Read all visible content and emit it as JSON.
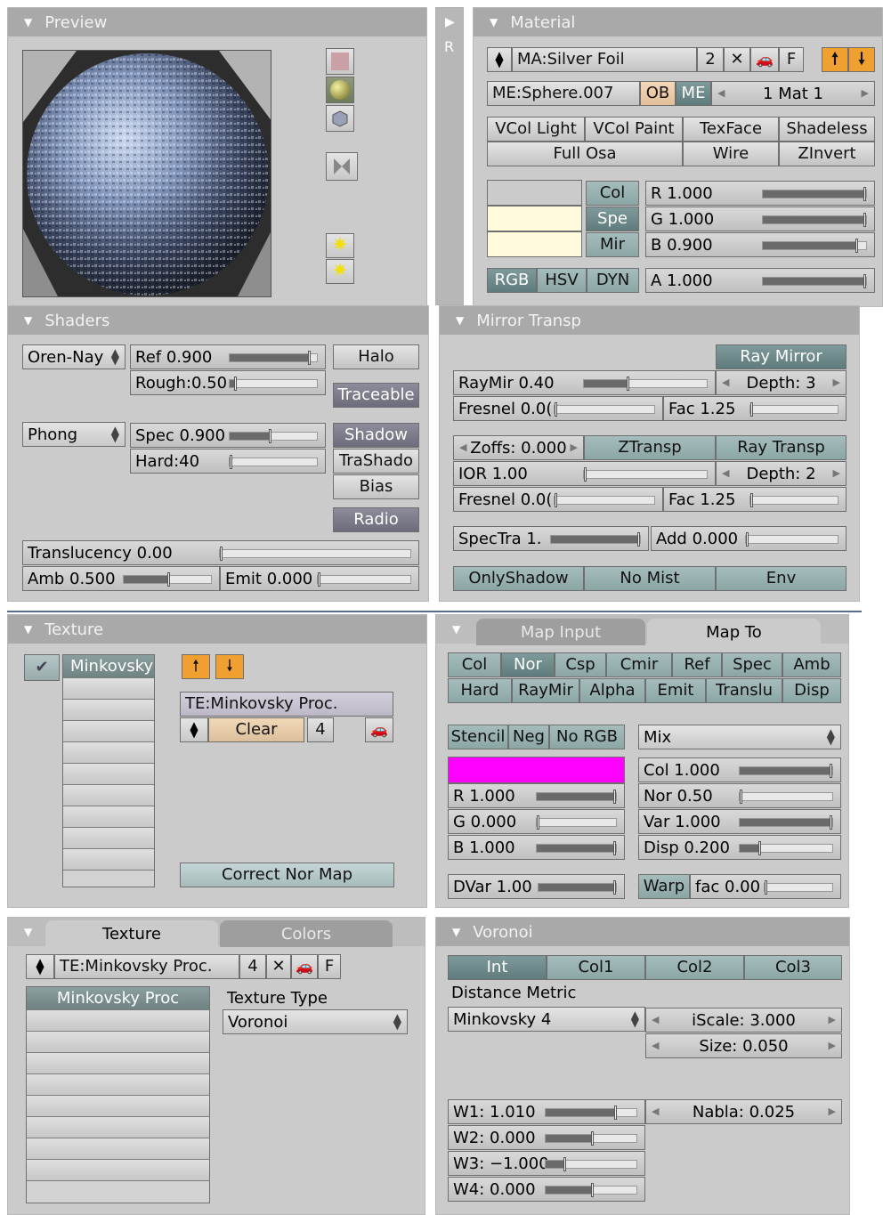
{
  "preview": {
    "title": "Preview"
  },
  "material": {
    "title": "Material",
    "side_label": "R",
    "ma_name": "MA:Silver Foil",
    "users": "2",
    "f_label": "F",
    "me_name": "ME:Sphere.007",
    "ob": "OB",
    "me": "ME",
    "mat_index": "1 Mat 1",
    "toggles": [
      "VCol Light",
      "VCol Paint",
      "TexFace",
      "Shadeless",
      "Full Osa",
      "Wire",
      "ZInvert"
    ],
    "color_tabs": [
      "Col",
      "Spe",
      "Mir"
    ],
    "mode_tabs": [
      "RGB",
      "HSV",
      "DYN"
    ],
    "sliders": [
      {
        "label": "R 1.000",
        "value": 1.0
      },
      {
        "label": "G 1.000",
        "value": 1.0
      },
      {
        "label": "B 0.900",
        "value": 0.9
      },
      {
        "label": "A 1.000",
        "value": 1.0
      }
    ],
    "swatch_colors": [
      "#cbcbcb",
      "#fffbdc",
      "#fffbdc"
    ]
  },
  "shaders": {
    "title": "Shaders",
    "diffuse": "Oren-Nay",
    "specular": "Phong",
    "ref": {
      "label": "Ref   0.900",
      "value": 0.9
    },
    "rough": {
      "label": "Rough:0.50",
      "value": 0.05
    },
    "spec": {
      "label": "Spec 0.900",
      "value": 0.45
    },
    "hard": {
      "label": "Hard:40",
      "value": 0.0
    },
    "halo": "Halo",
    "traceable": "Traceable",
    "shadow": "Shadow",
    "trashado": "TraShado",
    "bias": "Bias",
    "radio": "Radio",
    "translucency": {
      "label": "Translucency 0.00",
      "value": 0.0
    },
    "amb": {
      "label": "Amb 0.500",
      "value": 0.5
    },
    "emit": {
      "label": "Emit 0.000",
      "value": 0.0
    }
  },
  "mirror": {
    "title": "Mirror Transp",
    "ray_mirror": "Ray Mirror",
    "raymir": {
      "label": "RayMir 0.40",
      "value": 0.4
    },
    "depth1": "Depth: 3",
    "fresnel1": {
      "label": "Fresnel 0.0(",
      "value": 0.0
    },
    "fac1": {
      "label": "Fac 1.25",
      "value": 0.0
    },
    "zoffs": "Zoffs: 0.000",
    "ztransp": "ZTransp",
    "ray_transp": "Ray Transp",
    "ior": {
      "label": "IOR 1.00",
      "value": 0.0
    },
    "depth2": "Depth: 2",
    "fresnel2": {
      "label": "Fresnel 0.0(",
      "value": 0.0
    },
    "fac2": {
      "label": "Fac 1.25",
      "value": 0.0
    },
    "spectra": {
      "label": "SpecTra 1.",
      "value": 1.0
    },
    "add": {
      "label": "Add 0.000",
      "value": 0.0
    },
    "onlyshadow": "OnlyShadow",
    "nomist": "No Mist",
    "env": "Env"
  },
  "texture": {
    "title": "Texture",
    "slot_name": "Minkovsky",
    "te_name": "TE:Minkovsky Proc.",
    "clear": "Clear",
    "users": "4",
    "correct": "Correct Nor Map"
  },
  "mapto": {
    "tab_input": "Map Input",
    "tab_to": "Map To",
    "row1": [
      "Col",
      "Nor",
      "Csp",
      "Cmir",
      "Ref",
      "Spec",
      "Amb"
    ],
    "row2": [
      "Hard",
      "RayMir",
      "Alpha",
      "Emit",
      "Translu",
      "Disp"
    ],
    "stencil": "Stencil",
    "neg": "Neg",
    "norgb": "No RGB",
    "blend": "Mix",
    "color": "#ff00ff",
    "r": {
      "label": "R 1.000",
      "value": 1.0
    },
    "g": {
      "label": "G 0.000",
      "value": 0.0
    },
    "b": {
      "label": "B 1.000",
      "value": 1.0
    },
    "dvar": {
      "label": "DVar 1.00",
      "value": 1.0
    },
    "col": {
      "label": "Col 1.000",
      "value": 1.0
    },
    "nor": {
      "label": "Nor 0.50",
      "value": 0.0
    },
    "var": {
      "label": "Var 1.000",
      "value": 1.0
    },
    "disp": {
      "label": "Disp 0.200",
      "value": 0.2
    },
    "warp": "Warp",
    "fac": {
      "label": "fac 0.00",
      "value": 0.0
    }
  },
  "textab": {
    "tab_texture": "Texture",
    "tab_colors": "Colors",
    "te_name": "TE:Minkovsky Proc.",
    "users": "4",
    "f_label": "F",
    "list_item": "Minkovsky Proc",
    "type_label": "Texture Type",
    "type_value": "Voronoi"
  },
  "voronoi": {
    "title": "Voronoi",
    "tabs": [
      "Int",
      "Col1",
      "Col2",
      "Col3"
    ],
    "distance_label": "Distance Metric",
    "metric": "Minkovsky 4",
    "iscale": "iScale: 3.000",
    "size": "Size: 0.050",
    "w1": {
      "label": "W1: 1.010",
      "value": 0.6
    },
    "w2": {
      "label": "W2: 0.000",
      "value": 0.5
    },
    "w3": {
      "label": "W3: −1.000",
      "value": 0.2
    },
    "w4": {
      "label": "W4: 0.000",
      "value": 0.5
    },
    "nabla": "Nabla: 0.025"
  }
}
